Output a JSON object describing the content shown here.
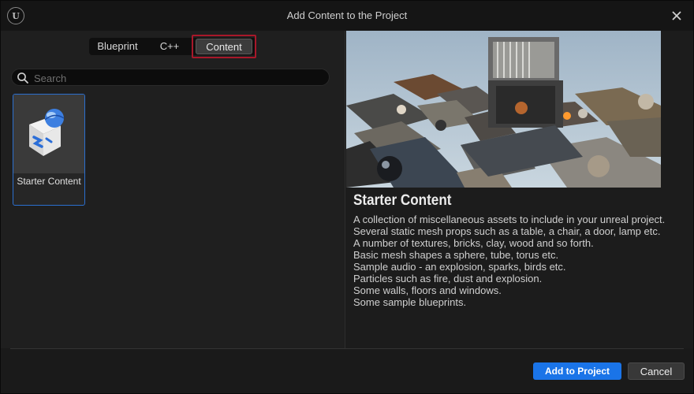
{
  "window": {
    "title": "Add Content to the Project",
    "logo_icon": "unreal-logo-icon",
    "close_icon": "close-icon"
  },
  "tabs": [
    {
      "label": "Blueprint",
      "selected": false
    },
    {
      "label": "C++",
      "selected": false
    },
    {
      "label": "Content",
      "selected": true
    }
  ],
  "search": {
    "placeholder": "Search",
    "value": ""
  },
  "items": [
    {
      "label": "Starter Content",
      "selected": true,
      "icon": "starter-content-box-icon"
    }
  ],
  "detail": {
    "title": "Starter Content",
    "description": [
      "A collection of miscellaneous assets to include in your unreal project.",
      "Several static mesh props such as a table, a chair, a door, lamp etc.",
      "A number of textures, bricks, clay, wood and so forth.",
      "Basic mesh shapes a sphere, tube, torus etc.",
      "Sample audio - an explosion, sparks, birds etc.",
      "Particles such as fire, dust and explosion.",
      "Some walls, floors and windows.",
      "Some sample blueprints."
    ]
  },
  "buttons": {
    "add": "Add to Project",
    "cancel": "Cancel"
  },
  "colors": {
    "accent": "#1a74e8",
    "selection_border": "#a8182a",
    "tile_border": "#2b6fcf"
  }
}
